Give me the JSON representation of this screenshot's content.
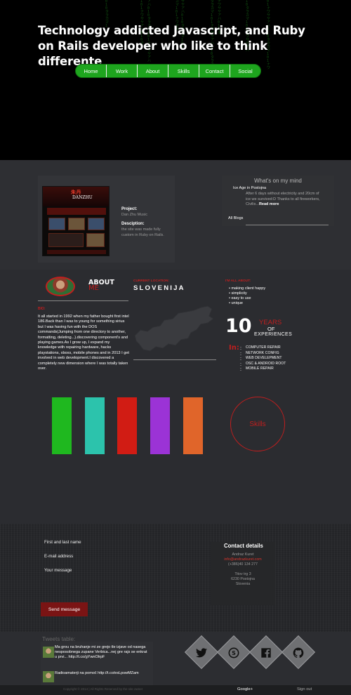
{
  "hero": {
    "title": "Technology addicted Javascript, and Ruby on Rails developer who like to think differente"
  },
  "nav": {
    "items": [
      "Home",
      "Work",
      "About",
      "Skills",
      "Contact",
      "Social"
    ],
    "color": "#1ea51e"
  },
  "project": {
    "project_label": "Project:",
    "project_name": "Dan Zhu Music",
    "description_label": "Desciption:",
    "description_text": "the site was made fully custom in Ruby on Rails.",
    "thumbnail_logo": "朱丹",
    "thumbnail_logo_latin": "DANZHU"
  },
  "mind": {
    "title": "What's on my mind",
    "post_title": "Ice Age in Postojna",
    "post_body": "After 6 days without electricity and 20cm of ice we survived:D Thanks to all fireworkers, Civilis...",
    "read_more": "Read more",
    "all_blogs": "All Blogs"
  },
  "about": {
    "title": "ABOUT",
    "subtitle": "ME",
    "bio_label": "BIO:",
    "bio_text": "It all started in 1992 when my father bought first intel 186.Back than I was to young for something sirius but I was having fun with the DOS commands(Jumping from one directory to another, formatting, deleting...).discovering component's and playing games.As I grow up, I expand my knowledge with repairing hardware, hacks playstations, xboxs, mobile phones and in 2013 I get involved in web development.I discovered a completely new dimension where I was totally taken over.",
    "location_label": "CURRENT LOCATION:",
    "location_value": "SLOVENIJA",
    "all_about_label": "I'M ALL ABOUT:",
    "all_about": [
      "making client happy",
      "simplicity",
      "easy to use",
      "unique"
    ],
    "years_number": "10",
    "years_word": "YEARS",
    "years_of": "OF",
    "years_experiences": "EXPERIENCES",
    "in_label": "In:",
    "in_items": [
      "COMPUTER REPAIR",
      "NETWORK CONFIG",
      "WEB DEVELEPMENT",
      "OSC & ANDROID ROOT",
      "MOBILE REPAIR"
    ],
    "accent_color": "#c21e1e"
  },
  "skills": {
    "label": "Skills",
    "bar_colors": [
      "#1fb81f",
      "#2cc3ac",
      "#d11c14",
      "#9b33d6",
      "#e0652a"
    ]
  },
  "contact": {
    "name_label": "First and last name",
    "email_label": "E-mail address",
    "message_label": "Your message",
    "send_label": "Send message",
    "details_title": "Contact details",
    "details_name": "Andraz Kuret",
    "details_email": "info@andrazkuret.com",
    "details_phone": "(+386)40 134 277",
    "details_street": "Titov trg 3",
    "details_city": "6230 Postojna",
    "details_country": "Slovenia"
  },
  "tweets": {
    "title": "Tweets table:",
    "items": [
      "Ma grou na bruhanje mi ze grejo tle izjave od nasega nesposobnega zupane Verbica...nej gre rajs se enkrat u prvi... http://t.co/gYwnOlrpF",
      "Radioamaterji na pomoč http://t.co/esLpswMZam"
    ]
  },
  "social": {
    "icons": [
      "twitter-icon",
      "skype-icon",
      "facebook-icon",
      "github-icon"
    ]
  },
  "footer": {
    "copyright": "Copyright © 2014 | All Rights Reserved by the site owner",
    "gplus": "Google+",
    "signout": "Sign out"
  }
}
